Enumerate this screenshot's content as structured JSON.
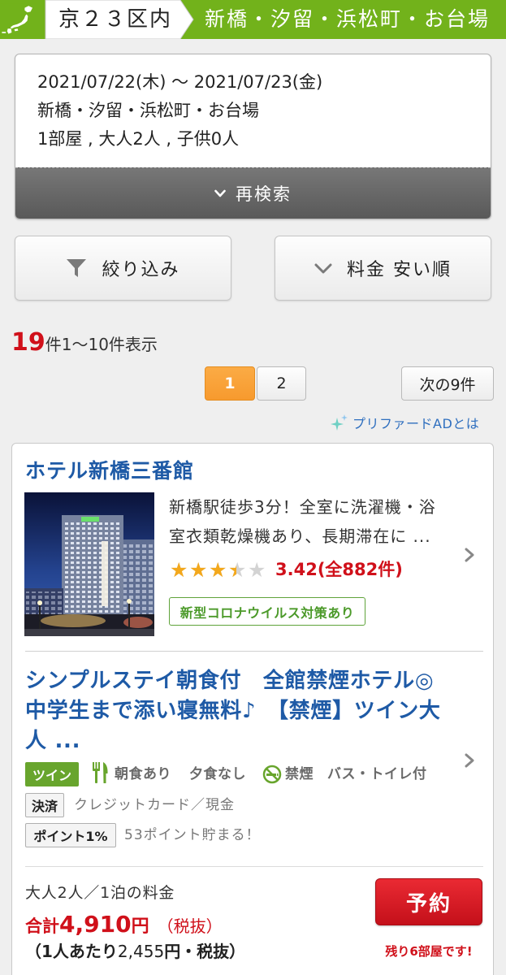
{
  "colors": {
    "header_green": "#72b21b",
    "accent_red": "#d0101a",
    "link_blue": "#1e5aa6",
    "page_active_orange": "#f79a2e",
    "tag_green": "#68a52d",
    "star_gold": "#f3a81c"
  },
  "icons": {
    "breadcrumb": "japan-map-icon",
    "research": "chevron-down-icon",
    "filter": "funnel-icon",
    "sort": "chevron-down-icon",
    "ad": "sparkle-icon",
    "meal": "fork-knife-icon",
    "smoking": "no-smoking-icon",
    "detail": "chevron-right-icon"
  },
  "breadcrumb": {
    "region": "京２３区内",
    "area": "新橋・汐留・浜松町・お台場"
  },
  "search": {
    "dates": "2021/07/22(木) 〜 2021/07/23(金)",
    "area": "新橋・汐留・浜松町・お台場",
    "guests": "1部屋 , 大人2人 , 子供0人",
    "research_label": "再検索"
  },
  "filters": {
    "filter_label": "絞り込み",
    "sort_label": "料金 安い順"
  },
  "results": {
    "total": "19",
    "summary": "件1〜10件表示"
  },
  "pagination": {
    "pages": [
      "1",
      "2"
    ],
    "current_page": "1",
    "next_label": "次の9件"
  },
  "ad_link": "プリファードADとは",
  "hotel": {
    "name": "ホテル新橋三番館",
    "description": "新橋駅徒歩3分！全室に洗濯機・浴室衣類乾燥機あり、長期滞在に ...",
    "rating": {
      "value": "3.42",
      "reviews": "(全882件)",
      "max_stars": 5
    },
    "covid_badge": "新型コロナウイルス対策あり",
    "plan": {
      "title": "シンプルステイ朝食付　全館禁煙ホテル◎中学生まで添い寝無料♪　【禁煙】ツイン大人 ...",
      "room_type": "ツイン",
      "breakfast": "朝食あり",
      "dinner": "夕食なし",
      "smoking": "禁煙",
      "bath": "バス・トイレ付",
      "payment_label": "決済",
      "payment_methods": "クレジットカード／現金",
      "points_label": "ポイント1%",
      "points_text": "53ポイント貯まる！"
    },
    "price": {
      "condition": "大人2人／1泊の料金",
      "total_prefix": "合計",
      "total_amount": "4,910",
      "total_unit": "円",
      "tax_note": "（税抜）",
      "per_person_prefix": "（1人あたり",
      "per_person_amount": "2,455",
      "per_person_suffix": "円・税抜）",
      "reserve_label": "予約",
      "rooms_left": "残り6部屋です!"
    }
  }
}
